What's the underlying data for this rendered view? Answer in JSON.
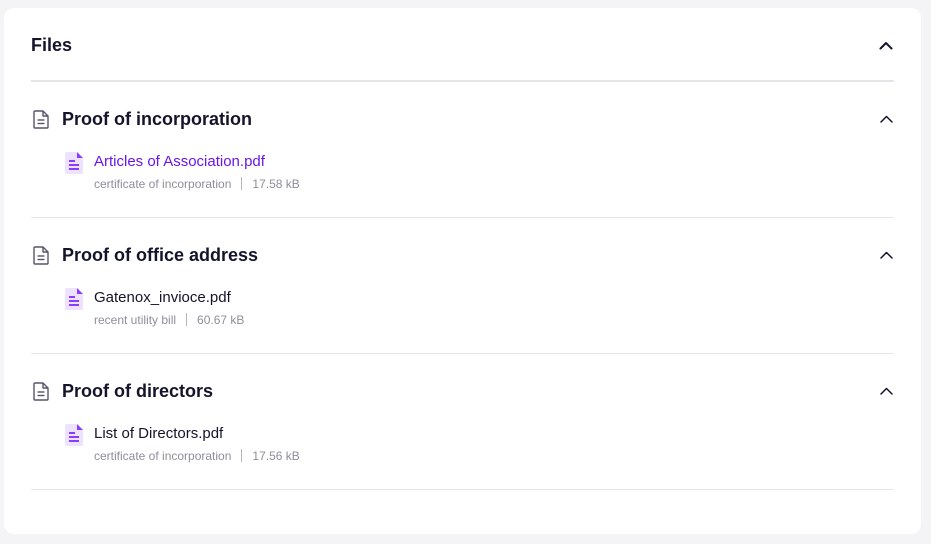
{
  "panel": {
    "title": "Files",
    "collapse_icon": "chevron-up-icon"
  },
  "sections": [
    {
      "title": "Proof of incorporation",
      "icon": "document-icon",
      "file": {
        "name": "Articles of Association.pdf",
        "description": "certificate of incorporation",
        "size": "17.58 kB",
        "highlighted": true
      }
    },
    {
      "title": "Proof of office address",
      "icon": "document-icon",
      "file": {
        "name": "Gatenox_invioce.pdf",
        "description": "recent utility bill",
        "size": "60.67 kB",
        "highlighted": false
      }
    },
    {
      "title": "Proof of directors",
      "icon": "document-icon",
      "file": {
        "name": "List of Directors.pdf",
        "description": "certificate of incorporation",
        "size": "17.56 kB",
        "highlighted": false
      }
    }
  ],
  "colors": {
    "link": "#6b16e6",
    "pdf_icon": "#8b3dff",
    "pdf_icon_bg": "#ede2ff",
    "heading": "#14142b",
    "muted": "#8e8e9a"
  }
}
